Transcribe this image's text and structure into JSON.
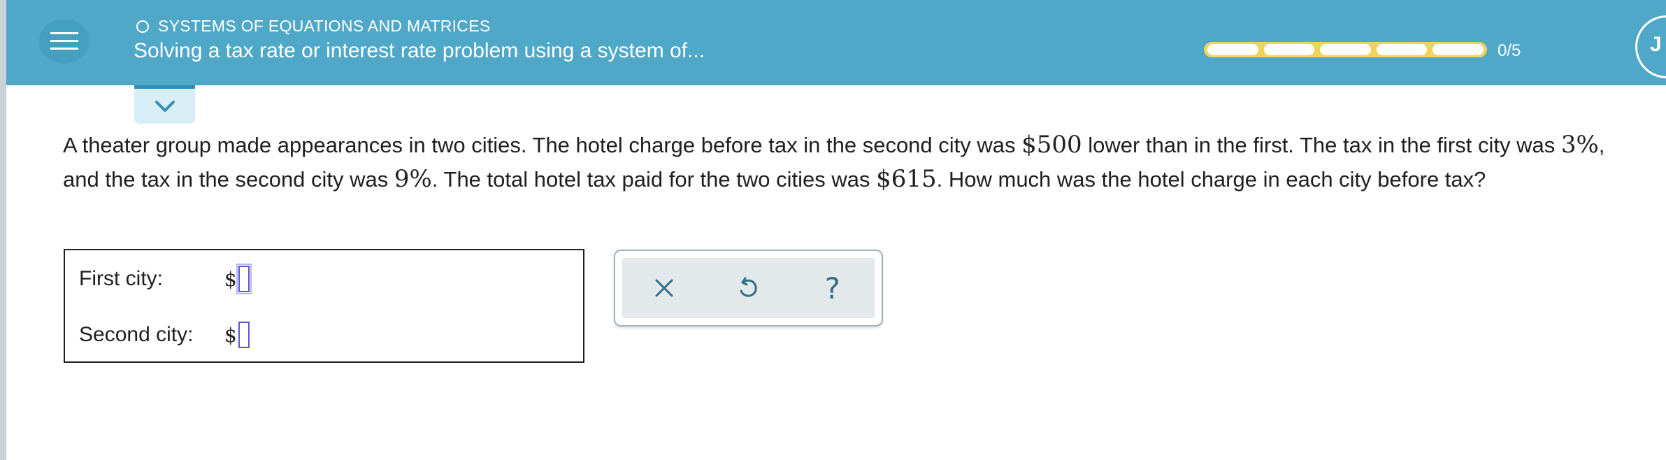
{
  "header": {
    "topic": "SYSTEMS OF EQUATIONS AND MATRICES",
    "title": "Solving a tax rate or interest rate problem using a system of...",
    "progress_label": "0/5",
    "progress_fraction": 0,
    "avatar_initial": "J",
    "menu_icon": "hamburger-icon",
    "collapse_icon": "chevron-down-icon"
  },
  "question": {
    "p1": "A theater group made appearances in two cities. The hotel charge before tax in the second city was ",
    "m1": "$500",
    "p2": " lower than in the first. The tax in the first city was ",
    "m2": "3%",
    "p3": ", and the tax in the second city was ",
    "m3": "9%",
    "p4": ". The total hotel tax paid for the two cities was ",
    "m4": "$615",
    "p5": ". How much was the hotel charge in each city before tax?"
  },
  "answer": {
    "first_label": "First city:",
    "second_label": "Second city:",
    "currency": "$",
    "first_value": "",
    "second_value": ""
  },
  "tools": {
    "clear_icon": "close-icon",
    "undo_icon": "undo-icon",
    "help_label": "?"
  },
  "colors": {
    "header_bg": "#4fa8c7",
    "progress_track": "#f1d35a",
    "input_border": "#5b56d6",
    "tool_icon": "#2f6f8a"
  }
}
